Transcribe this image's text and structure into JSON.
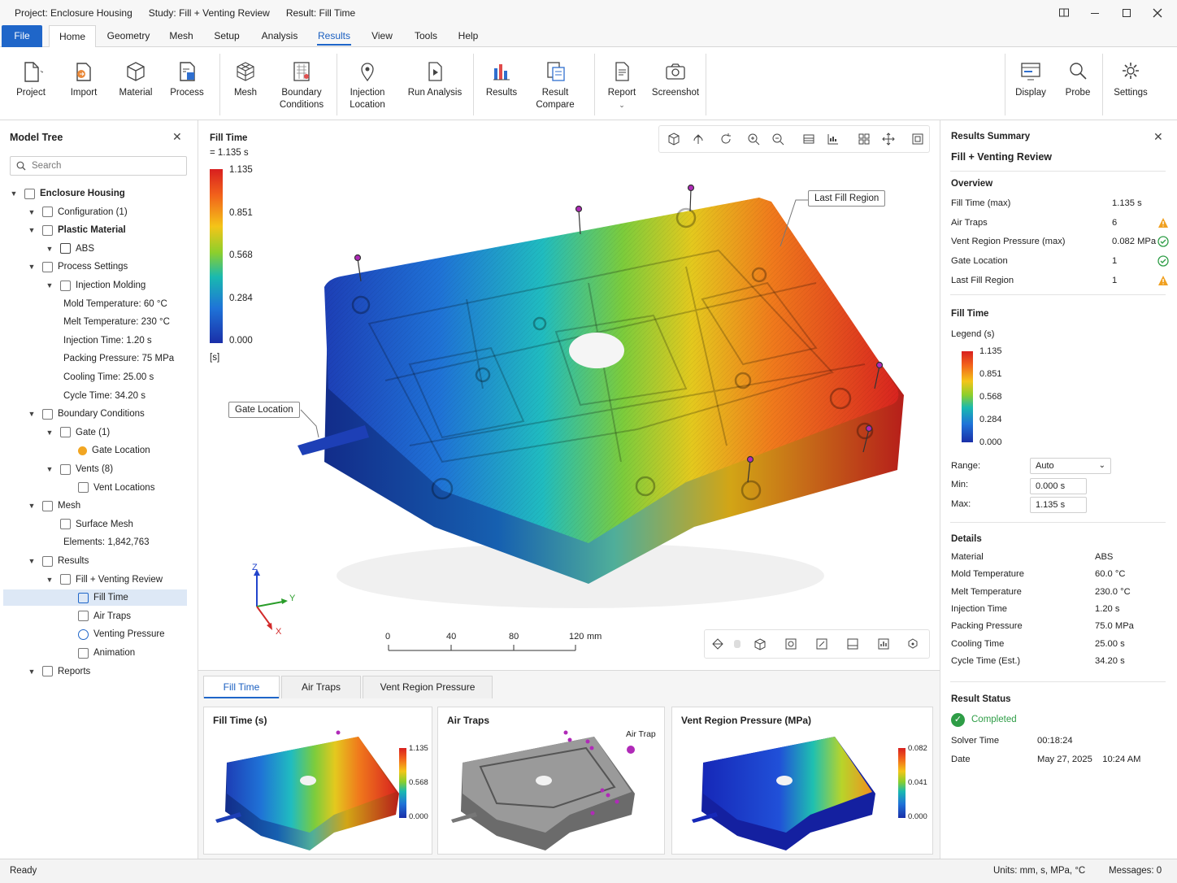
{
  "titlebar": {
    "project": "Project: Enclosure Housing",
    "study": "Study: Fill + Venting Review",
    "result": "Result: Fill Time"
  },
  "menu": {
    "tabs": [
      "File",
      "Home",
      "Geometry",
      "Mesh",
      "Setup",
      "Analysis",
      "Results",
      "View",
      "Tools",
      "Help"
    ],
    "active_tab": "Results"
  },
  "ribbon": {
    "project": "Project",
    "import": "Import",
    "material": "Material",
    "process": "Process",
    "mesh": "Mesh",
    "boundary_1": "Boundary",
    "boundary_2": "Conditions",
    "injection_1": "Injection",
    "injection_2": "Location",
    "run_analysis": "Run Analysis",
    "results": "Results",
    "compare_1": "Result",
    "compare_2": "Compare",
    "report": "Report",
    "screenshot": "Screenshot",
    "display": "Display",
    "probe": "Probe",
    "settings": "Settings"
  },
  "model_tree": {
    "title": "Model Tree",
    "search_placeholder": "Search",
    "items": [
      {
        "label": "Enclosure Housing",
        "bold": true
      },
      {
        "label": "Configuration (1)"
      },
      {
        "label": "Plastic Material",
        "bold": true
      },
      {
        "label": "ABS"
      },
      {
        "label": "Process Settings"
      },
      {
        "label": "Injection Molding"
      },
      {
        "label": "Mold Temperature:  60 °C"
      },
      {
        "label": "Melt Temperature:  230 °C"
      },
      {
        "label": "Injection Time:  1.20 s"
      },
      {
        "label": "Packing Pressure:  75 MPa"
      },
      {
        "label": "Cooling Time:  25.00 s"
      },
      {
        "label": "Cycle Time:  34.20 s"
      },
      {
        "label": "Boundary Conditions"
      },
      {
        "label": "Gate (1)"
      },
      {
        "label": "Gate Location"
      },
      {
        "label": "Vents (8)"
      },
      {
        "label": "Vent Locations"
      },
      {
        "label": "Mesh"
      },
      {
        "label": "Surface Mesh"
      },
      {
        "label": "Elements:  1,842,763"
      },
      {
        "label": "Results"
      },
      {
        "label": "Fill + Venting Review"
      },
      {
        "label": "Fill Time",
        "selected": true
      },
      {
        "label": "Air Traps"
      },
      {
        "label": "Venting Pressure"
      },
      {
        "label": "Animation"
      },
      {
        "label": "Reports"
      }
    ]
  },
  "viewport": {
    "result_title": "Fill Time",
    "result_value": "= 1.135 s",
    "legend_ticks": [
      "1.135",
      "0.851",
      "0.568",
      "0.284",
      "0.000"
    ],
    "legend_unit": "[s]",
    "callout_last_fill": "Last Fill Region",
    "callout_gate": "Gate Location",
    "axis_z": "Z",
    "axis_y": "Y",
    "axis_x": "X",
    "scale_ticks": [
      "0",
      "40",
      "80",
      "120"
    ],
    "scale_unit": "mm"
  },
  "bottom": {
    "tabs": [
      "Fill Time",
      "Air Traps",
      "Vent Region Pressure"
    ],
    "active_tab": "Fill Time",
    "thumb1_title": "Fill Time (s)",
    "thumb1_ticks": [
      "1.135",
      "0.568",
      "0.000"
    ],
    "thumb2_title": "Air Traps",
    "thumb2_legend": "Air Trap",
    "thumb3_title": "Vent Region Pressure (MPa)",
    "thumb3_ticks": [
      "0.082",
      "0.041",
      "0.000"
    ]
  },
  "summary": {
    "title": "Results Summary",
    "study": "Fill + Venting Review",
    "overview_title": "Overview",
    "overview": [
      {
        "label": "Fill Time (max)",
        "value": "1.135 s",
        "status": ""
      },
      {
        "label": "Air Traps",
        "value": "6",
        "status": "warning"
      },
      {
        "label": "Vent Region Pressure (max)",
        "value": "0.082 MPa",
        "status": "ok"
      },
      {
        "label": "Gate Location",
        "value": "1",
        "status": "ok"
      },
      {
        "label": "Last Fill Region",
        "value": "1",
        "status": "warning"
      }
    ],
    "fill_title": "Fill Time",
    "legend_label": "Legend  (s)",
    "legend_ticks": [
      "1.135",
      "0.851",
      "0.568",
      "0.284",
      "0.000"
    ],
    "range_label": "Range:",
    "range_value": "Auto",
    "min_label": "Min:",
    "min_value": "0.000 s",
    "max_label": "Max:",
    "max_value": "1.135 s",
    "details_title": "Details",
    "details": [
      {
        "label": "Material",
        "value": "ABS"
      },
      {
        "label": "Mold Temperature",
        "value": "60.0 °C"
      },
      {
        "label": "Melt Temperature",
        "value": "230.0 °C"
      },
      {
        "label": "Injection Time",
        "value": "1.20 s"
      },
      {
        "label": "Packing Pressure",
        "value": "75.0 MPa"
      },
      {
        "label": "Cooling Time",
        "value": "25.00 s"
      },
      {
        "label": "Cycle Time (Est.)",
        "value": "34.20 s"
      }
    ],
    "status_title": "Result Status",
    "status_value": "Completed",
    "solver_label": "Solver Time",
    "solver_value": "00:18:24",
    "date_label": "Date",
    "date_value": "May 27, 2025    10:24 AM"
  },
  "status": {
    "left": "Ready",
    "units": "Units:  mm, s, MPa, °C",
    "messages": "Messages:  0"
  },
  "colors": {
    "accent": "#1f66c9",
    "warning": "#f0a020",
    "ok": "#2e9d46",
    "vent_marker": "#b02ab8"
  }
}
